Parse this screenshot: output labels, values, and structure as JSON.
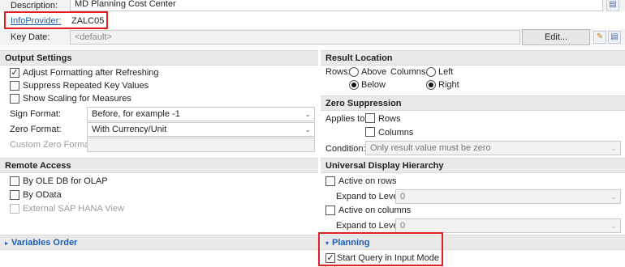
{
  "header": {
    "description_label": "Description:",
    "description_value": "MD Planning Cost Center",
    "infoprovider_label": "InfoProvider:",
    "infoprovider_value": "ZALC05",
    "keydate_label": "Key Date:",
    "keydate_value": "<default>",
    "edit_button": "Edit..."
  },
  "output_settings": {
    "title": "Output Settings",
    "adjust_formatting": "Adjust Formatting after Refreshing",
    "suppress_repeated": "Suppress Repeated Key Values",
    "show_scaling": "Show Scaling for Measures",
    "sign_format_label": "Sign Format:",
    "sign_format_value": "Before, for example -1",
    "zero_format_label": "Zero Format:",
    "zero_format_value": "With Currency/Unit",
    "custom_zero_format_label": "Custom Zero Format:",
    "custom_zero_format_value": ""
  },
  "result_location": {
    "title": "Result Location",
    "rows_label": "Rows:",
    "above": "Above",
    "below": "Below",
    "columns_label": "Columns:",
    "left": "Left",
    "right": "Right"
  },
  "zero_suppression": {
    "title": "Zero Suppression",
    "applies_to_label": "Applies to:",
    "rows": "Rows",
    "columns": "Columns",
    "condition_label": "Condition:",
    "condition_value": "Only result value must be zero"
  },
  "remote_access": {
    "title": "Remote Access",
    "ole_db": "By OLE DB for OLAP",
    "odata": "By OData",
    "hana_view": "External SAP HANA View"
  },
  "universal_display": {
    "title": "Universal Display Hierarchy",
    "active_rows": "Active on rows",
    "expand_label_rows": "Expand to Level:",
    "expand_value_rows": "0",
    "active_columns": "Active on columns",
    "expand_label_cols": "Expand to Level:",
    "expand_value_cols": "0"
  },
  "variables_order": {
    "title": "Variables Order"
  },
  "planning": {
    "title": "Planning",
    "start_query_input": "Start Query in Input Mode"
  },
  "icons": {
    "dropdown": "chevron-down-icon",
    "pencil": "pencil-icon",
    "value_help": "value-help-icon"
  },
  "colors": {
    "highlight": "#e02020",
    "link": "#1a5fb4",
    "section_header": "#e9e9e9"
  }
}
